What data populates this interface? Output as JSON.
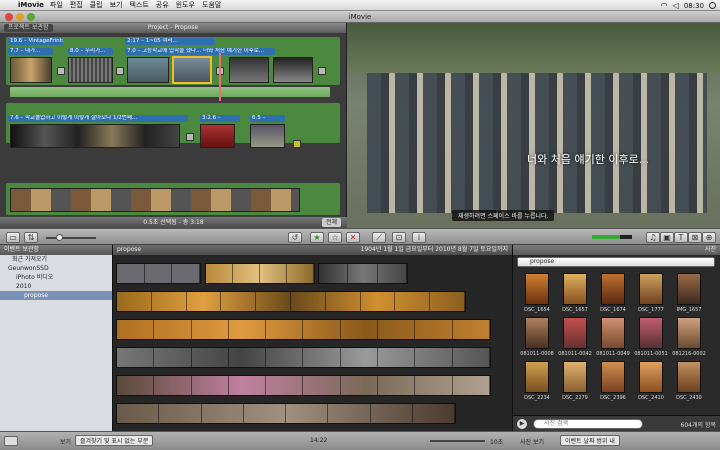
{
  "menubar": {
    "app_name": "iMovie",
    "items": [
      "파일",
      "편집",
      "클립",
      "보기",
      "텍스트",
      "공유",
      "윈도우",
      "도움말"
    ],
    "clock": "08:30"
  },
  "window": {
    "title": "iMovie"
  },
  "project": {
    "library_button": "프로젝트 보관함",
    "title": "Project - Propose",
    "themes": [
      "19.6 – VintageFrints",
      "7.7 – 내가...",
      "8.0 – 우리가...",
      "2:17 – 1~05 여러...",
      "7.0 – 고등학교에 입학을 했다... 너와 처음 얘기한 이후로...",
      "7.6 – 학교졸업하고 이렇게 이렇게 살아오다 1/2번째...",
      "3:2.6 –",
      "6.5 –"
    ],
    "selection_text": "0.5초 선택됨 - 총 3:18",
    "zoom_label": "전체"
  },
  "viewer": {
    "caption": "너와 처음 얘기한 이후로...",
    "tip": "재생하려면 스페이스 바를 누릅니다."
  },
  "events": {
    "header": "이벤트 보관함",
    "items": [
      "최근 가져오기",
      "GeunwonSSD",
      "iPhoto 비디오",
      "2010",
      "propose"
    ]
  },
  "browser": {
    "event_name": "propose",
    "date_range": "1904년 1월 1일 금요일부터 2010년 8월 7일 토요일까지"
  },
  "photos": {
    "header": "사진",
    "album": "propose",
    "labels": [
      "DSC_1654",
      "DSC_1657",
      "DSC_1674",
      "DSC_1777",
      "IMG_1657",
      "081011-0008",
      "081011-0042",
      "081011-0049",
      "081011-0051",
      "081216-0002",
      "DSC_2234",
      "DSC_2279",
      "DSC_2396",
      "DSC_2410",
      "DSC_2430"
    ],
    "search_placeholder": "사진 검색",
    "count": "604개의 항목"
  },
  "statusbar": {
    "show_label": "보기",
    "filter": "즐겨찾기 및 표시 없는 부분",
    "duration": "14:22",
    "speed": "10초",
    "photo_checkbox": "사진 보기",
    "photo_filter": "이벤트 날짜 범위 내"
  },
  "colors": {
    "project_green": "#4b8a3e",
    "theme_blue": "#2e6fb0",
    "selection_yellow": "#f0c020"
  }
}
